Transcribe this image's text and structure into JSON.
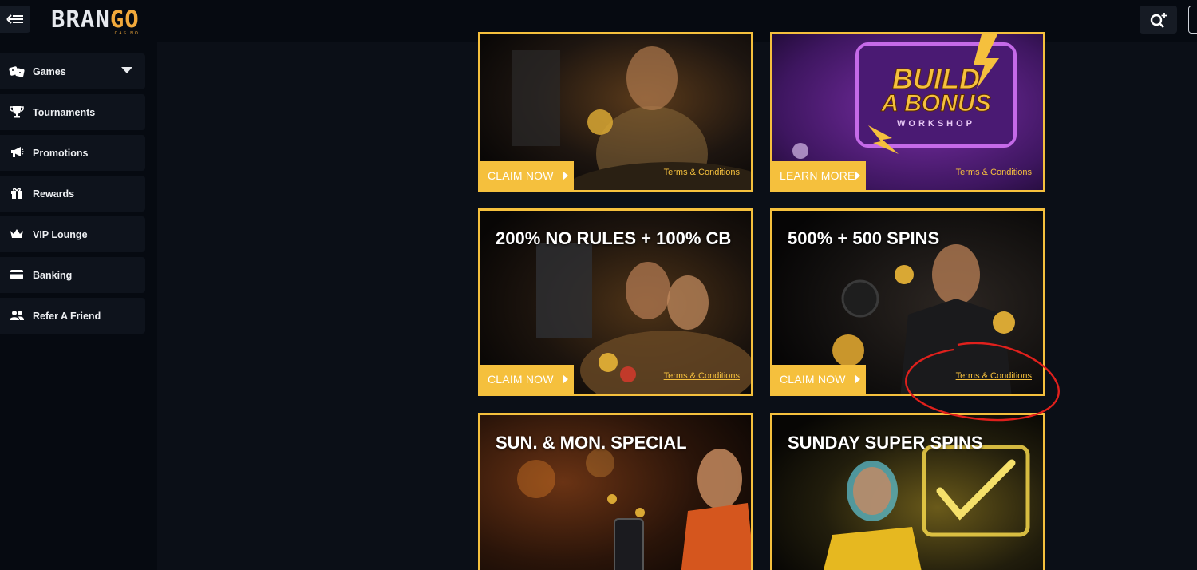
{
  "header": {
    "logo_text_a": "BRAN",
    "logo_text_b": "GO",
    "logo_sub": "CASINO",
    "back_icon": "collapse-menu-icon",
    "search_icon": "search-sparkle-icon"
  },
  "sidebar": {
    "items": [
      {
        "label": "Games",
        "icon": "dice-icon",
        "has_dropdown": true
      },
      {
        "label": "Tournaments",
        "icon": "trophy-icon"
      },
      {
        "label": "Promotions",
        "icon": "megaphone-icon"
      },
      {
        "label": "Rewards",
        "icon": "gift-icon"
      },
      {
        "label": "VIP Lounge",
        "icon": "crown-icon"
      },
      {
        "label": "Banking",
        "icon": "card-icon"
      },
      {
        "label": "Refer A Friend",
        "icon": "users-icon"
      }
    ]
  },
  "promos": [
    {
      "title": "",
      "cta": "CLAIM NOW",
      "terms": "Terms & Conditions",
      "art_text": ""
    },
    {
      "title": "",
      "cta": "LEARN MORE",
      "terms": "Terms & Conditions",
      "art_text_1": "BUILD",
      "art_text_2": "A BONUS",
      "art_text_3": "WORKSHOP"
    },
    {
      "title": "200% NO RULES + 100% CB",
      "cta": "CLAIM NOW",
      "terms": "Terms & Conditions"
    },
    {
      "title": "500% + 500 SPINS",
      "cta": "CLAIM NOW",
      "terms": "Terms & Conditions"
    },
    {
      "title": "SUN. & MON. SPECIAL",
      "cta": "",
      "terms": ""
    },
    {
      "title": "SUNDAY SUPER SPINS",
      "cta": "",
      "terms": ""
    }
  ],
  "colors": {
    "accent": "#f5c03d",
    "annotation": "#e0201c",
    "background": "#0b0f17"
  }
}
